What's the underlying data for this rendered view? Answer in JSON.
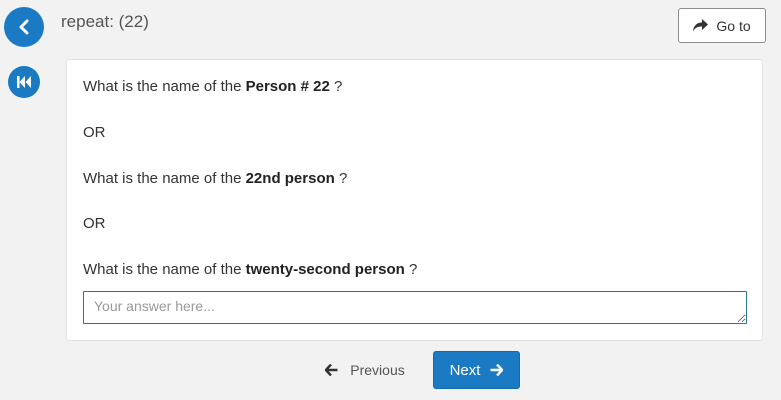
{
  "header": {
    "title": "repeat: (22)",
    "goto_label": "Go to"
  },
  "question": {
    "line1_prefix": "What is the name of the ",
    "line1_bold": "Person # 22",
    "line1_suffix": " ?",
    "or1": "OR",
    "line2_prefix": "What is the name of the ",
    "line2_bold": "22nd person",
    "line2_suffix": " ?",
    "or2": "OR",
    "line3_prefix": "What is the name of the ",
    "line3_bold": "twenty-second person",
    "line3_suffix": " ?"
  },
  "answer": {
    "value": "",
    "placeholder": "Your answer here..."
  },
  "nav": {
    "previous_label": "Previous",
    "next_label": "Next"
  },
  "colors": {
    "accent": "#1a7ac4",
    "background": "#f2f2f2",
    "input_border": "#2a7b87"
  },
  "icons": {
    "back": "chevron-left-icon",
    "rewind": "fast-backward-icon",
    "goto": "share-arrow-icon",
    "previous": "arrow-left-icon",
    "next": "arrow-right-icon"
  }
}
